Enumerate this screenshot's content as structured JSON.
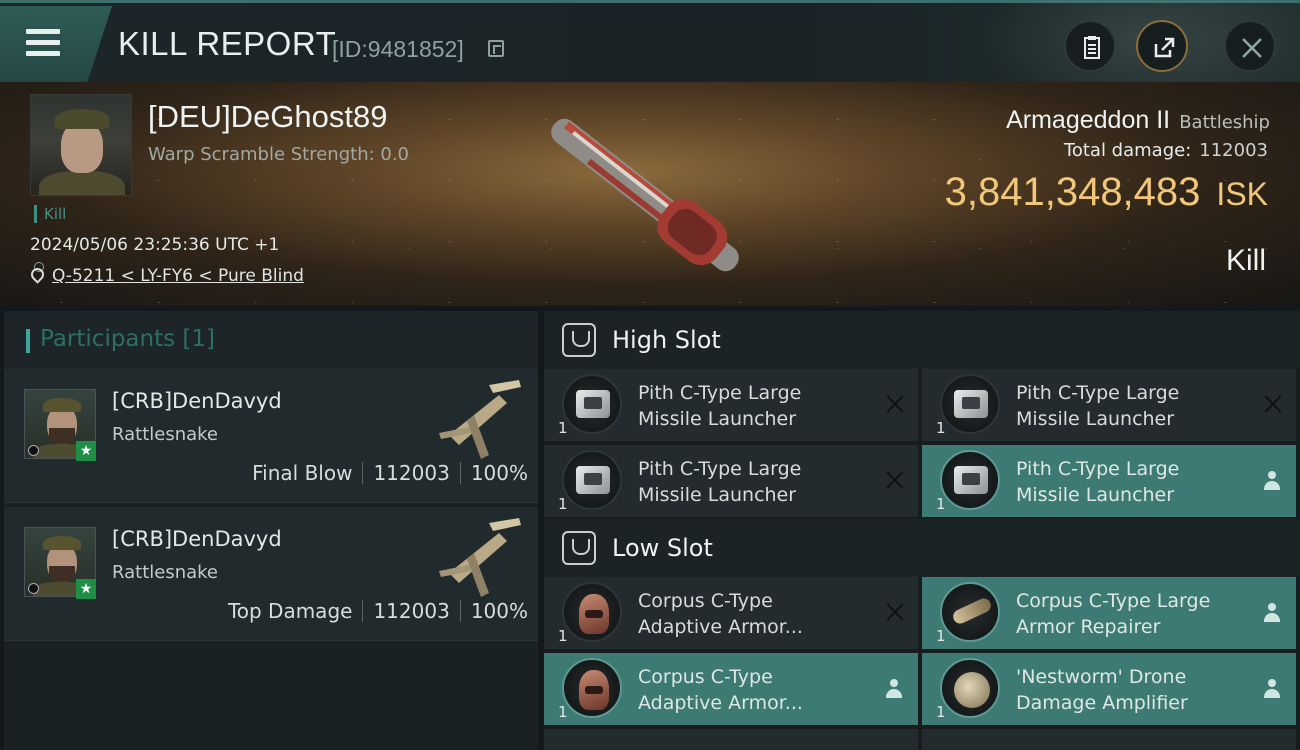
{
  "header": {
    "title": "KILL REPORT",
    "report_id": "[ID:9481852]"
  },
  "victim": {
    "name": "[DEU]DeGhost89",
    "warp_scramble": "Warp Scramble Strength: 0.0",
    "tag": "Kill",
    "datetime": "2024/05/06 23:25:36 UTC +1",
    "location": "Q-5211 < LY-FY6 < Pure Blind"
  },
  "ship": {
    "name": "Armageddon II",
    "class": "Battleship",
    "total_damage_label": "Total damage:",
    "total_damage": "112003",
    "isk_value": "3,841,348,483",
    "isk_unit": "ISK",
    "result": "Kill"
  },
  "participants": {
    "title": "Participants [1]",
    "items": [
      {
        "name": "[CRB]DenDavyd",
        "ship": "Rattlesnake",
        "role": "Final Blow",
        "damage": "112003",
        "percent": "100%"
      },
      {
        "name": "[CRB]DenDavyd",
        "ship": "Rattlesnake",
        "role": "Top Damage",
        "damage": "112003",
        "percent": "100%"
      }
    ]
  },
  "slots": {
    "high": {
      "title": "High Slot",
      "items": [
        {
          "line1": "Pith C-Type Large",
          "line2": "Missile Launcher",
          "qty": "1",
          "status": "destroyed"
        },
        {
          "line1": "Pith C-Type Large",
          "line2": "Missile Launcher",
          "qty": "1",
          "status": "destroyed"
        },
        {
          "line1": "Pith C-Type Large",
          "line2": "Missile Launcher",
          "qty": "1",
          "status": "destroyed"
        },
        {
          "line1": "Pith C-Type Large",
          "line2": "Missile Launcher",
          "qty": "1",
          "status": "dropped"
        }
      ]
    },
    "low": {
      "title": "Low Slot",
      "items": [
        {
          "line1": "Corpus C-Type",
          "line2": "Adaptive Armor...",
          "qty": "1",
          "status": "destroyed"
        },
        {
          "line1": "Corpus C-Type Large",
          "line2": "Armor Repairer",
          "qty": "1",
          "status": "dropped"
        },
        {
          "line1": "Corpus C-Type",
          "line2": "Adaptive Armor...",
          "qty": "1",
          "status": "dropped"
        },
        {
          "line1": "'Nestworm' Drone",
          "line2": "Damage Amplifier",
          "qty": "1",
          "status": "dropped"
        }
      ]
    }
  },
  "colors": {
    "accent_teal": "#3e7a74",
    "isk_gold": "#f2c77a"
  },
  "icons": [
    "menu-icon",
    "copy-icon",
    "clipboard-icon",
    "share-icon",
    "close-icon",
    "location-pin-icon",
    "slot-icon",
    "destroyed-x-icon",
    "dropped-person-icon",
    "star-icon"
  ]
}
